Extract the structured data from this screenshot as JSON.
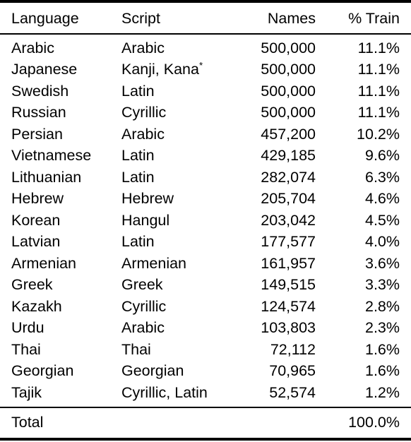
{
  "table": {
    "columns": [
      {
        "key": "language",
        "label": "Language",
        "align": "left"
      },
      {
        "key": "script",
        "label": "Script",
        "align": "left"
      },
      {
        "key": "names",
        "label": "Names",
        "align": "right"
      },
      {
        "key": "pct_train",
        "label": "% Train",
        "align": "right"
      }
    ],
    "rows": [
      {
        "language": "Arabic",
        "script": "Arabic",
        "script_footnote": "",
        "names": "500,000",
        "pct_train": "11.1%"
      },
      {
        "language": "Japanese",
        "script": "Kanji, Kana",
        "script_footnote": "*",
        "names": "500,000",
        "pct_train": "11.1%"
      },
      {
        "language": "Swedish",
        "script": "Latin",
        "script_footnote": "",
        "names": "500,000",
        "pct_train": "11.1%"
      },
      {
        "language": "Russian",
        "script": "Cyrillic",
        "script_footnote": "",
        "names": "500,000",
        "pct_train": "11.1%"
      },
      {
        "language": "Persian",
        "script": "Arabic",
        "script_footnote": "",
        "names": "457,200",
        "pct_train": "10.2%"
      },
      {
        "language": "Vietnamese",
        "script": "Latin",
        "script_footnote": "",
        "names": "429,185",
        "pct_train": "9.6%"
      },
      {
        "language": "Lithuanian",
        "script": "Latin",
        "script_footnote": "",
        "names": "282,074",
        "pct_train": "6.3%"
      },
      {
        "language": "Hebrew",
        "script": "Hebrew",
        "script_footnote": "",
        "names": "205,704",
        "pct_train": "4.6%"
      },
      {
        "language": "Korean",
        "script": "Hangul",
        "script_footnote": "",
        "names": "203,042",
        "pct_train": "4.5%"
      },
      {
        "language": "Latvian",
        "script": "Latin",
        "script_footnote": "",
        "names": "177,577",
        "pct_train": "4.0%"
      },
      {
        "language": "Armenian",
        "script": "Armenian",
        "script_footnote": "",
        "names": "161,957",
        "pct_train": "3.6%"
      },
      {
        "language": "Greek",
        "script": "Greek",
        "script_footnote": "",
        "names": "149,515",
        "pct_train": "3.3%"
      },
      {
        "language": "Kazakh",
        "script": "Cyrillic",
        "script_footnote": "",
        "names": "124,574",
        "pct_train": "2.8%"
      },
      {
        "language": "Urdu",
        "script": "Arabic",
        "script_footnote": "",
        "names": "103,803",
        "pct_train": "2.3%"
      },
      {
        "language": "Thai",
        "script": "Thai",
        "script_footnote": "",
        "names": "72,112",
        "pct_train": "1.6%"
      },
      {
        "language": "Georgian",
        "script": "Georgian",
        "script_footnote": "",
        "names": "70,965",
        "pct_train": "1.6%"
      },
      {
        "language": "Tajik",
        "script": "Cyrillic, Latin",
        "script_footnote": "",
        "names": "52,574",
        "pct_train": "1.2%"
      }
    ],
    "total": {
      "label": "Total",
      "script": "",
      "names": "",
      "pct_train": "100.0%"
    }
  },
  "chart_data": {
    "type": "table",
    "title": "",
    "columns": [
      "Language",
      "Script",
      "Names",
      "% Train"
    ],
    "categories": [
      "Arabic",
      "Japanese",
      "Swedish",
      "Russian",
      "Persian",
      "Vietnamese",
      "Lithuanian",
      "Hebrew",
      "Korean",
      "Latvian",
      "Armenian",
      "Greek",
      "Kazakh",
      "Urdu",
      "Thai",
      "Georgian",
      "Tajik"
    ],
    "series": [
      {
        "name": "Names",
        "values": [
          500000,
          500000,
          500000,
          500000,
          457200,
          429185,
          282074,
          205704,
          203042,
          177577,
          161957,
          149515,
          124574,
          103803,
          72112,
          70965,
          52574
        ]
      },
      {
        "name": "% Train",
        "values": [
          11.1,
          11.1,
          11.1,
          11.1,
          10.2,
          9.6,
          6.3,
          4.6,
          4.5,
          4.0,
          3.6,
          3.3,
          2.8,
          2.3,
          1.6,
          1.6,
          1.2
        ]
      }
    ],
    "scripts": [
      "Arabic",
      "Kanji, Kana*",
      "Latin",
      "Cyrillic",
      "Arabic",
      "Latin",
      "Latin",
      "Hebrew",
      "Hangul",
      "Latin",
      "Armenian",
      "Greek",
      "Cyrillic",
      "Arabic",
      "Thai",
      "Georgian",
      "Cyrillic, Latin"
    ],
    "total_pct_train": 100.0
  }
}
